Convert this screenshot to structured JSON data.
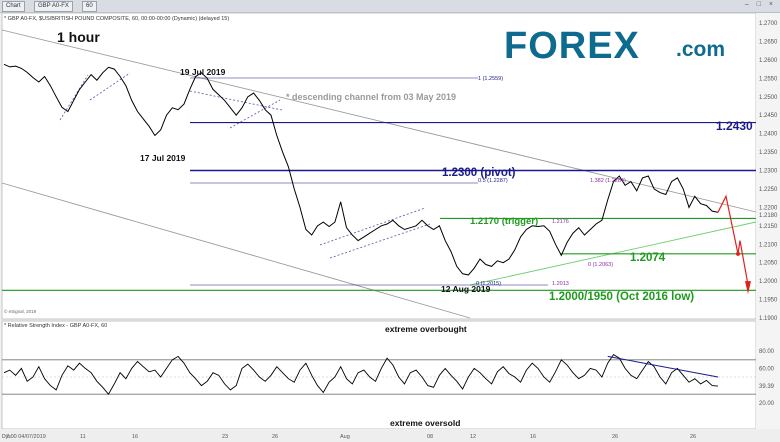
{
  "window": {
    "title_tab": "Chart",
    "symbol_tab": "GBP A0-FX",
    "interval_tab": "60",
    "controls": "– □ ×"
  },
  "brand": {
    "logo_text": "FOREX",
    "logo_suffix": ".com",
    "logo_color": "#0e6b8f",
    "accent_color": "#14a3d6"
  },
  "colors": {
    "price": "#000000",
    "blue_line": "#1a1a8c",
    "green": "#1e9a1e",
    "red": "#e0201c",
    "channel": "#9a9a9a",
    "rsi": "#000000"
  },
  "chart_data": [
    {
      "type": "line",
      "panel": "price",
      "header": "* GBP A0-FX, $US/BRITISH POUND COMPOSITE, 60, 00:00-00:00 (Dynamic) (delayed 15)",
      "timeframe_label": "1 hour",
      "x_tick_labels": [
        "7.00 04/07/2019",
        "11",
        "16",
        "23",
        "26",
        "Aug",
        "08",
        "12",
        "16",
        "26",
        "26"
      ],
      "y_tick_labels": [
        "1.2700",
        "1.2650",
        "1.2600",
        "1.2550",
        "1.2500",
        "1.2450",
        "1.2400",
        "1.2350",
        "1.2300",
        "1.2250",
        "1.2200",
        "1.2180",
        "1.2150",
        "1.2100",
        "1.2050",
        "1.2000",
        "1.1950",
        "1.1900"
      ],
      "ylim": [
        1.19,
        1.27
      ],
      "series": [
        {
          "type": "line",
          "values": [
            [
              0,
              1.2588
            ],
            [
              1,
              1.2581
            ],
            [
              2,
              1.2583
            ],
            [
              3,
              1.2577
            ],
            [
              4,
              1.2566
            ],
            [
              5,
              1.2552
            ],
            [
              6,
              1.254
            ],
            [
              7,
              1.2555
            ],
            [
              8,
              1.253
            ],
            [
              9,
              1.25
            ],
            [
              10,
              1.2471
            ],
            [
              11,
              1.246
            ],
            [
              12,
              1.249
            ],
            [
              13,
              1.252
            ],
            [
              14,
              1.254
            ],
            [
              15,
              1.256
            ],
            [
              16,
              1.2545
            ],
            [
              17,
              1.2565
            ],
            [
              18,
              1.258
            ],
            [
              19,
              1.2575
            ],
            [
              20,
              1.2555
            ],
            [
              21,
              1.253
            ],
            [
              22,
              1.249
            ],
            [
              23,
              1.246
            ],
            [
              24,
              1.244
            ],
            [
              25,
              1.242
            ],
            [
              26,
              1.2395
            ],
            [
              27,
              1.241
            ],
            [
              28,
              1.245
            ],
            [
              29,
              1.247
            ],
            [
              30,
              1.2465
            ],
            [
              31,
              1.248
            ],
            [
              32,
              1.252
            ],
            [
              33,
              1.2555
            ],
            [
              34,
              1.2565
            ],
            [
              35,
              1.255
            ],
            [
              36,
              1.252
            ],
            [
              37,
              1.2505
            ],
            [
              38,
              1.249
            ],
            [
              39,
              1.247
            ],
            [
              40,
              1.245
            ],
            [
              41,
              1.247
            ],
            [
              42,
              1.25
            ],
            [
              43,
              1.251
            ],
            [
              44,
              1.249
            ],
            [
              45,
              1.2465
            ],
            [
              46,
              1.245
            ],
            [
              47,
              1.2395
            ],
            [
              48,
              1.235
            ],
            [
              49,
              1.231
            ],
            [
              50,
              1.225
            ],
            [
              51,
              1.22
            ],
            [
              52,
              1.214
            ],
            [
              53,
              1.2125
            ],
            [
              54,
              1.215
            ],
            [
              55,
              1.216
            ],
            [
              56,
              1.2148
            ],
            [
              57,
              1.216
            ],
            [
              58,
              1.2215
            ],
            [
              59,
              1.2145
            ],
            [
              60,
              1.2125
            ],
            [
              61,
              1.211
            ],
            [
              62,
              1.212
            ],
            [
              63,
              1.213
            ],
            [
              64,
              1.214
            ],
            [
              65,
              1.215
            ],
            [
              66,
              1.2155
            ],
            [
              67,
              1.2165
            ],
            [
              68,
              1.215
            ],
            [
              69,
              1.214
            ],
            [
              70,
              1.2145
            ],
            [
              71,
              1.215
            ],
            [
              72,
              1.2165
            ],
            [
              73,
              1.215
            ],
            [
              74,
              1.214
            ],
            [
              75,
              1.215
            ],
            [
              76,
              1.211
            ],
            [
              77,
              1.208
            ],
            [
              78,
              1.204
            ],
            [
              79,
              1.202
            ],
            [
              80,
              1.2017
            ],
            [
              81,
              1.2035
            ],
            [
              82,
              1.206
            ],
            [
              83,
              1.2045
            ],
            [
              84,
              1.204
            ],
            [
              85,
              1.2055
            ],
            [
              86,
              1.205
            ],
            [
              87,
              1.206
            ],
            [
              88,
              1.2085
            ],
            [
              89,
              1.212
            ],
            [
              90,
              1.214
            ],
            [
              91,
              1.215
            ],
            [
              92,
              1.2148
            ],
            [
              93,
              1.215
            ],
            [
              94,
              1.2135
            ],
            [
              95,
              1.21
            ],
            [
              96,
              1.207
            ],
            [
              97,
              1.2105
            ],
            [
              98,
              1.213
            ],
            [
              99,
              1.2145
            ],
            [
              100,
              1.2125
            ],
            [
              101,
              1.214
            ],
            [
              102,
              1.2155
            ],
            [
              103,
              1.2165
            ],
            [
              104,
              1.222
            ],
            [
              105,
              1.227
            ],
            [
              106,
              1.2285
            ],
            [
              107,
              1.226
            ],
            [
              108,
              1.227
            ],
            [
              109,
              1.2245
            ],
            [
              110,
              1.228
            ],
            [
              111,
              1.2285
            ],
            [
              112,
              1.225
            ],
            [
              113,
              1.224
            ],
            [
              114,
              1.2235
            ],
            [
              115,
              1.227
            ],
            [
              116,
              1.228
            ],
            [
              117,
              1.225
            ],
            [
              118,
              1.22
            ],
            [
              119,
              1.223
            ],
            [
              120,
              1.221
            ],
            [
              121,
              1.2205
            ],
            [
              122,
              1.219
            ],
            [
              123,
              1.2187
            ]
          ]
        }
      ],
      "levels": [
        {
          "label": "1.2430",
          "value": 1.243,
          "color": "#1a1a8c"
        },
        {
          "label": "1.2300 (pivot)",
          "value": 1.23,
          "color": "#1a1a8c"
        },
        {
          "label": "1.2170 (trigger)",
          "value": 1.217,
          "color": "#1e9a1e"
        },
        {
          "label": "1.2074",
          "value": 1.2074,
          "color": "#1e9a1e"
        },
        {
          "label": "1.2000/1950 (Oct 2016 low)",
          "value": 1.1975,
          "color": "#1e9a1e"
        }
      ],
      "annotations": [
        {
          "text": "19 Jul 2019"
        },
        {
          "text": "17 Jul 2019"
        },
        {
          "text": "12 Aug 2019"
        },
        {
          "text": "* descending channel from 03 May 2019"
        }
      ],
      "fib_labels": [
        {
          "text": "1.2559",
          "alt": "1 (1.2559)"
        },
        {
          "text": "0.5 (1.2287)"
        },
        {
          "text": "1.382 (1.2284)"
        },
        {
          "text": "1.2176"
        },
        {
          "text": "0 (1.2063)"
        },
        {
          "text": "1.2013"
        },
        {
          "text": "0 (1.2015)"
        }
      ],
      "watermark": "© eSignal, 2019"
    },
    {
      "type": "line",
      "panel": "rsi",
      "header": "* Relative Strength Index - GBP A0-FX, 60",
      "ylim": [
        0,
        100
      ],
      "y_tick_labels": [
        "80.00",
        "60.00",
        "39.39",
        "20.00"
      ],
      "bands": [
        {
          "label": "extreme overbought",
          "value": 70
        },
        {
          "label": "extreme oversold",
          "value": 30
        }
      ],
      "series": [
        {
          "name": "RSI",
          "values": [
            [
              0,
              55
            ],
            [
              1,
              58
            ],
            [
              2,
              52
            ],
            [
              3,
              60
            ],
            [
              4,
              45
            ],
            [
              5,
              50
            ],
            [
              6,
              62
            ],
            [
              7,
              48
            ],
            [
              8,
              40
            ],
            [
              9,
              35
            ],
            [
              10,
              52
            ],
            [
              11,
              63
            ],
            [
              12,
              58
            ],
            [
              13,
              66
            ],
            [
              14,
              60
            ],
            [
              15,
              55
            ],
            [
              16,
              45
            ],
            [
              17,
              38
            ],
            [
              18,
              30
            ],
            [
              19,
              42
            ],
            [
              20,
              55
            ],
            [
              21,
              48
            ],
            [
              22,
              60
            ],
            [
              23,
              68
            ],
            [
              24,
              62
            ],
            [
              25,
              56
            ],
            [
              26,
              58
            ],
            [
              27,
              50
            ],
            [
              28,
              60
            ],
            [
              29,
              70
            ],
            [
              30,
              74
            ],
            [
              31,
              66
            ],
            [
              32,
              55
            ],
            [
              33,
              48
            ],
            [
              34,
              40
            ],
            [
              35,
              45
            ],
            [
              36,
              55
            ],
            [
              37,
              52
            ],
            [
              38,
              42
            ],
            [
              39,
              35
            ],
            [
              40,
              40
            ],
            [
              41,
              60
            ],
            [
              42,
              65
            ],
            [
              43,
              58
            ],
            [
              44,
              50
            ],
            [
              45,
              45
            ],
            [
              46,
              52
            ],
            [
              47,
              62
            ],
            [
              48,
              55
            ],
            [
              49,
              48
            ],
            [
              50,
              44
            ],
            [
              51,
              58
            ],
            [
              52,
              66
            ],
            [
              53,
              52
            ],
            [
              54,
              40
            ],
            [
              55,
              32
            ],
            [
              56,
              44
            ],
            [
              57,
              50
            ],
            [
              58,
              62
            ],
            [
              59,
              48
            ],
            [
              60,
              42
            ],
            [
              61,
              55
            ],
            [
              62,
              58
            ],
            [
              63,
              50
            ],
            [
              64,
              45
            ],
            [
              65,
              60
            ],
            [
              66,
              72
            ],
            [
              67,
              64
            ],
            [
              68,
              50
            ],
            [
              69,
              42
            ],
            [
              70,
              55
            ],
            [
              71,
              58
            ],
            [
              72,
              50
            ],
            [
              73,
              40
            ],
            [
              74,
              38
            ],
            [
              75,
              52
            ],
            [
              76,
              60
            ],
            [
              77,
              52
            ],
            [
              78,
              45
            ],
            [
              79,
              36
            ],
            [
              80,
              50
            ],
            [
              81,
              60
            ],
            [
              82,
              55
            ],
            [
              83,
              48
            ],
            [
              84,
              42
            ],
            [
              85,
              56
            ],
            [
              86,
              62
            ],
            [
              87,
              54
            ],
            [
              88,
              50
            ],
            [
              89,
              44
            ],
            [
              90,
              58
            ],
            [
              91,
              66
            ],
            [
              92,
              60
            ],
            [
              93,
              50
            ],
            [
              94,
              44
            ],
            [
              95,
              56
            ],
            [
              96,
              70
            ],
            [
              97,
              64
            ],
            [
              98,
              55
            ],
            [
              99,
              48
            ],
            [
              100,
              52
            ],
            [
              101,
              60
            ],
            [
              102,
              58
            ],
            [
              103,
              50
            ],
            [
              104,
              66
            ],
            [
              105,
              76
            ],
            [
              106,
              72
            ],
            [
              107,
              60
            ],
            [
              108,
              52
            ],
            [
              109,
              48
            ],
            [
              110,
              58
            ],
            [
              111,
              68
            ],
            [
              112,
              62
            ],
            [
              113,
              50
            ],
            [
              114,
              42
            ],
            [
              115,
              55
            ],
            [
              116,
              60
            ],
            [
              117,
              52
            ],
            [
              118,
              44
            ],
            [
              119,
              48
            ],
            [
              120,
              42
            ],
            [
              121,
              46
            ],
            [
              122,
              40
            ],
            [
              123,
              39.39
            ]
          ]
        }
      ]
    }
  ],
  "bottom_bar": {
    "left_label": "Dys"
  }
}
